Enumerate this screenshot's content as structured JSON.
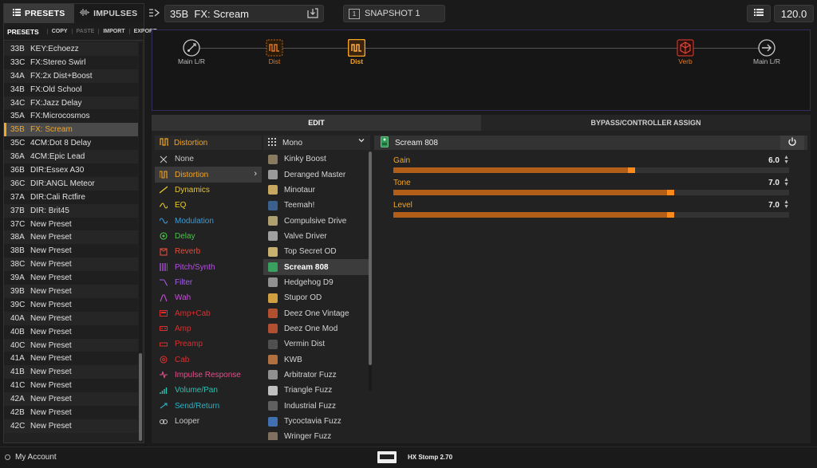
{
  "left_panel": {
    "tabs": [
      {
        "label": "PRESETS",
        "icon": "list-icon",
        "active": true
      },
      {
        "label": "IMPULSES",
        "icon": "waveform-icon",
        "active": false
      }
    ],
    "toolbar": {
      "title": "PRESETS",
      "actions": [
        "COPY",
        "PASTE",
        "IMPORT",
        "EXPORT"
      ]
    },
    "presets": [
      {
        "num": "33B",
        "name": "KEY:Echoezz"
      },
      {
        "num": "33C",
        "name": "FX:Stereo Swirl"
      },
      {
        "num": "34A",
        "name": "FX:2x Dist+Boost"
      },
      {
        "num": "34B",
        "name": "FX:Old School"
      },
      {
        "num": "34C",
        "name": "FX:Jazz Delay"
      },
      {
        "num": "35A",
        "name": "FX:Microcosmos"
      },
      {
        "num": "35B",
        "name": "FX: Scream",
        "selected": true
      },
      {
        "num": "35C",
        "name": "4CM:Dot 8 Delay"
      },
      {
        "num": "36A",
        "name": "4CM:Epic Lead"
      },
      {
        "num": "36B",
        "name": "DIR:Essex A30"
      },
      {
        "num": "36C",
        "name": "DIR:ANGL Meteor"
      },
      {
        "num": "37A",
        "name": "DIR:Cali Rctfire"
      },
      {
        "num": "37B",
        "name": "DIR: Brit45"
      },
      {
        "num": "37C",
        "name": "New Preset"
      },
      {
        "num": "38A",
        "name": "New Preset"
      },
      {
        "num": "38B",
        "name": "New Preset"
      },
      {
        "num": "38C",
        "name": "New Preset"
      },
      {
        "num": "39A",
        "name": "New Preset"
      },
      {
        "num": "39B",
        "name": "New Preset"
      },
      {
        "num": "39C",
        "name": "New Preset"
      },
      {
        "num": "40A",
        "name": "New Preset"
      },
      {
        "num": "40B",
        "name": "New Preset"
      },
      {
        "num": "40C",
        "name": "New Preset"
      },
      {
        "num": "41A",
        "name": "New Preset"
      },
      {
        "num": "41B",
        "name": "New Preset"
      },
      {
        "num": "41C",
        "name": "New Preset"
      },
      {
        "num": "42A",
        "name": "New Preset"
      },
      {
        "num": "42B",
        "name": "New Preset"
      },
      {
        "num": "42C",
        "name": "New Preset"
      }
    ]
  },
  "top_bar": {
    "preset_number": "35B",
    "preset_name": "FX: Scream",
    "snapshot_label": "SNAPSHOT 1",
    "snapshot_number": "1",
    "tempo": "120.0"
  },
  "signal_chain": {
    "blocks": [
      {
        "label": "Main L/R",
        "icon": "input-icon"
      },
      {
        "label": "Dist",
        "icon": "distortion-block-icon"
      },
      {
        "label": "Dist",
        "icon": "distortion-block-icon",
        "selected": true
      },
      {
        "label": "Verb",
        "icon": "reverb-block-icon"
      },
      {
        "label": "Main L/R",
        "icon": "output-arrow-icon"
      }
    ]
  },
  "edit_tabs": [
    "EDIT",
    "BYPASS/CONTROLLER ASSIGN"
  ],
  "categories": {
    "header": "Distortion",
    "items": [
      {
        "label": "None",
        "color": "#c8c8c8",
        "icon": "x-icon"
      },
      {
        "label": "Distortion",
        "color": "#f5a623",
        "icon": "distortion-icon",
        "selected": true
      },
      {
        "label": "Dynamics",
        "color": "#e5c430",
        "icon": "dynamics-icon"
      },
      {
        "label": "EQ",
        "color": "#e8cc2a",
        "icon": "eq-icon"
      },
      {
        "label": "Modulation",
        "color": "#3a9bd9",
        "icon": "modulation-icon"
      },
      {
        "label": "Delay",
        "color": "#4cc24c",
        "icon": "delay-icon"
      },
      {
        "label": "Reverb",
        "color": "#e84a3a",
        "icon": "reverb-icon"
      },
      {
        "label": "Pitch/Synth",
        "color": "#b550e0",
        "icon": "pitch-icon"
      },
      {
        "label": "Filter",
        "color": "#a060e0",
        "icon": "filter-icon"
      },
      {
        "label": "Wah",
        "color": "#c050d0",
        "icon": "wah-icon"
      },
      {
        "label": "Amp+Cab",
        "color": "#d83030",
        "icon": "amp-cab-icon"
      },
      {
        "label": "Amp",
        "color": "#d83030",
        "icon": "amp-icon"
      },
      {
        "label": "Preamp",
        "color": "#d83030",
        "icon": "preamp-icon"
      },
      {
        "label": "Cab",
        "color": "#d83030",
        "icon": "cab-icon"
      },
      {
        "label": "Impulse Response",
        "color": "#e0508a",
        "icon": "impulse-icon"
      },
      {
        "label": "Volume/Pan",
        "color": "#30c0b0",
        "icon": "volume-icon"
      },
      {
        "label": "Send/Return",
        "color": "#30b0c0",
        "icon": "send-return-icon"
      },
      {
        "label": "Looper",
        "color": "#c8c8c8",
        "icon": "looper-icon"
      }
    ]
  },
  "models": {
    "header": "Mono",
    "items": [
      {
        "label": "Kinky Boost",
        "color": "#8a7a60"
      },
      {
        "label": "Deranged Master",
        "color": "#9a9a9a"
      },
      {
        "label": "Minotaur",
        "color": "#c8a860"
      },
      {
        "label": "Teemah!",
        "color": "#3a6090"
      },
      {
        "label": "Compulsive Drive",
        "color": "#b0a070"
      },
      {
        "label": "Valve Driver",
        "color": "#a0a0a0"
      },
      {
        "label": "Top Secret OD",
        "color": "#c8b070"
      },
      {
        "label": "Scream 808",
        "color": "#3aa060",
        "selected": true
      },
      {
        "label": "Hedgehog D9",
        "color": "#909090"
      },
      {
        "label": "Stupor OD",
        "color": "#d0a040"
      },
      {
        "label": "Deez One Vintage",
        "color": "#b05030"
      },
      {
        "label": "Deez One Mod",
        "color": "#b05030"
      },
      {
        "label": "Vermin Dist",
        "color": "#505050"
      },
      {
        "label": "KWB",
        "color": "#b07040"
      },
      {
        "label": "Arbitrator Fuzz",
        "color": "#909090"
      },
      {
        "label": "Triangle Fuzz",
        "color": "#c0c0c0"
      },
      {
        "label": "Industrial Fuzz",
        "color": "#606060"
      },
      {
        "label": "Tycoctavia Fuzz",
        "color": "#4070b0"
      },
      {
        "label": "Wringer Fuzz",
        "color": "#807060"
      }
    ]
  },
  "params": {
    "model_name": "Scream 808",
    "items": [
      {
        "label": "Gain",
        "value": "6.0",
        "level": 0.6
      },
      {
        "label": "Tone",
        "value": "7.0",
        "level": 0.7
      },
      {
        "label": "Level",
        "value": "7.0",
        "level": 0.7
      }
    ]
  },
  "status_bar": {
    "account": "My Account",
    "device": "HX Stomp 2.70"
  },
  "colors": {
    "accent": "#f5a623",
    "chain_border": "#2f2d5c"
  }
}
